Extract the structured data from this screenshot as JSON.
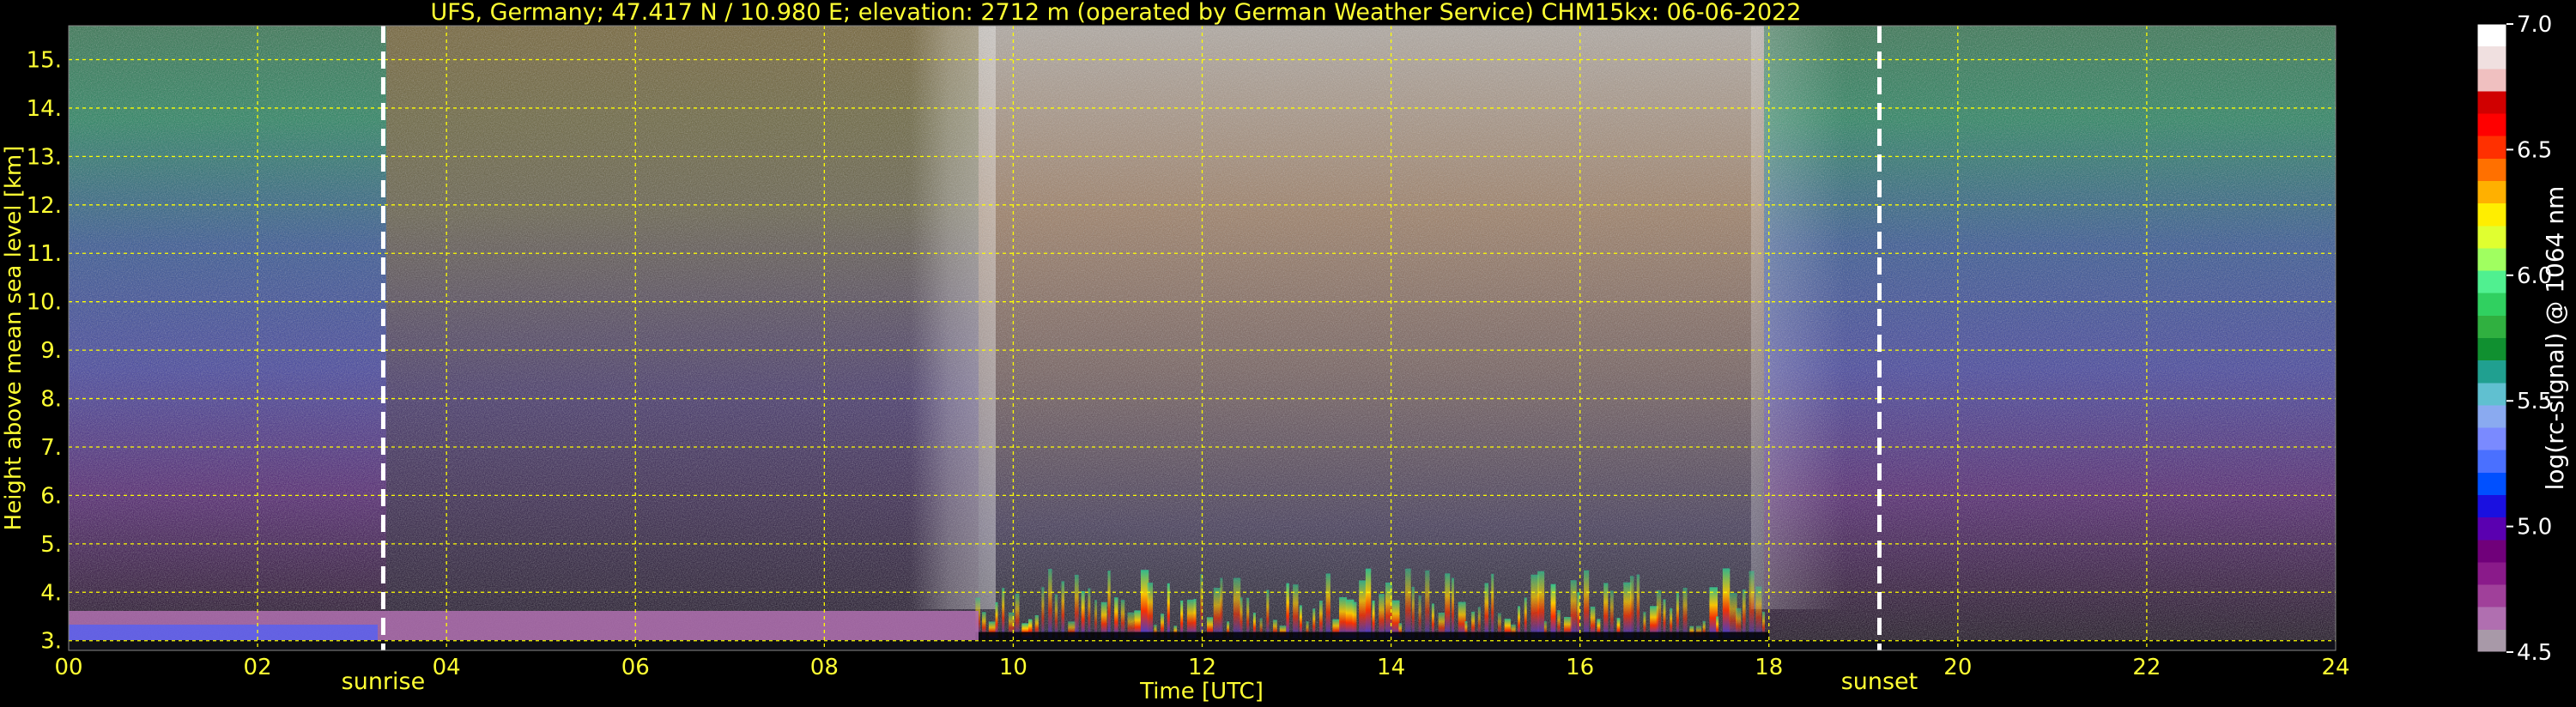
{
  "chart_data": {
    "type": "heatmap",
    "title": "UFS, Germany; 47.417 N / 10.980 E; elevation: 2712 m  (operated by German Weather Service)    CHM15kx: 06-06-2022",
    "xlabel": "Time [UTC]",
    "ylabel": "Height above mean sea level [km]",
    "xlim": [
      0,
      24
    ],
    "ylim": [
      2.8,
      15.7
    ],
    "x_ticks": [
      "00",
      "02",
      "04",
      "06",
      "08",
      "10",
      "12",
      "14",
      "16",
      "18",
      "20",
      "22",
      "24"
    ],
    "y_ticks": [
      "3.",
      "4.",
      "5.",
      "6.",
      "7.",
      "8.",
      "9.",
      "10.",
      "11.",
      "12.",
      "13.",
      "14.",
      "15."
    ],
    "grid": true,
    "colorbar": {
      "label": "log(rc-signal) @ 1064 nm",
      "range": [
        4.5,
        7.0
      ],
      "ticks": [
        "4.5",
        "5.0",
        "5.5",
        "6.0",
        "6.5",
        "7.0"
      ],
      "colors": [
        "#a899a8",
        "#b06fb0",
        "#a0409a",
        "#8a1a8a",
        "#70007a",
        "#5a00b0",
        "#1a10e0",
        "#0050ff",
        "#4a70ff",
        "#7a8aff",
        "#8aaaf0",
        "#60c0d0",
        "#20a090",
        "#109030",
        "#30b040",
        "#30d060",
        "#50f090",
        "#a0ff60",
        "#e0ff30",
        "#ffee00",
        "#ffb000",
        "#ff7000",
        "#ff3000",
        "#ff0000",
        "#d00000",
        "#f0c0c0",
        "#f0e0e0",
        "#ffffff"
      ]
    },
    "events": [
      {
        "name": "sunrise",
        "time": 3.33
      },
      {
        "name": "sunset",
        "time": 19.17
      }
    ],
    "signal_regions": [
      {
        "t_start": 0.0,
        "t_end": 24.0,
        "h_top": 15.7,
        "kind": "background-noise"
      },
      {
        "t_start": 9.6,
        "t_end": 18.2,
        "h_top": 15.7,
        "kind": "daytime-solar-noise"
      },
      {
        "t_start": 9.6,
        "t_end": 18.0,
        "h_top": 4.6,
        "kind": "convective-boundary-layer"
      },
      {
        "t_start": 0.0,
        "t_end": 9.6,
        "h_top": 3.5,
        "kind": "residual-layer"
      }
    ]
  }
}
